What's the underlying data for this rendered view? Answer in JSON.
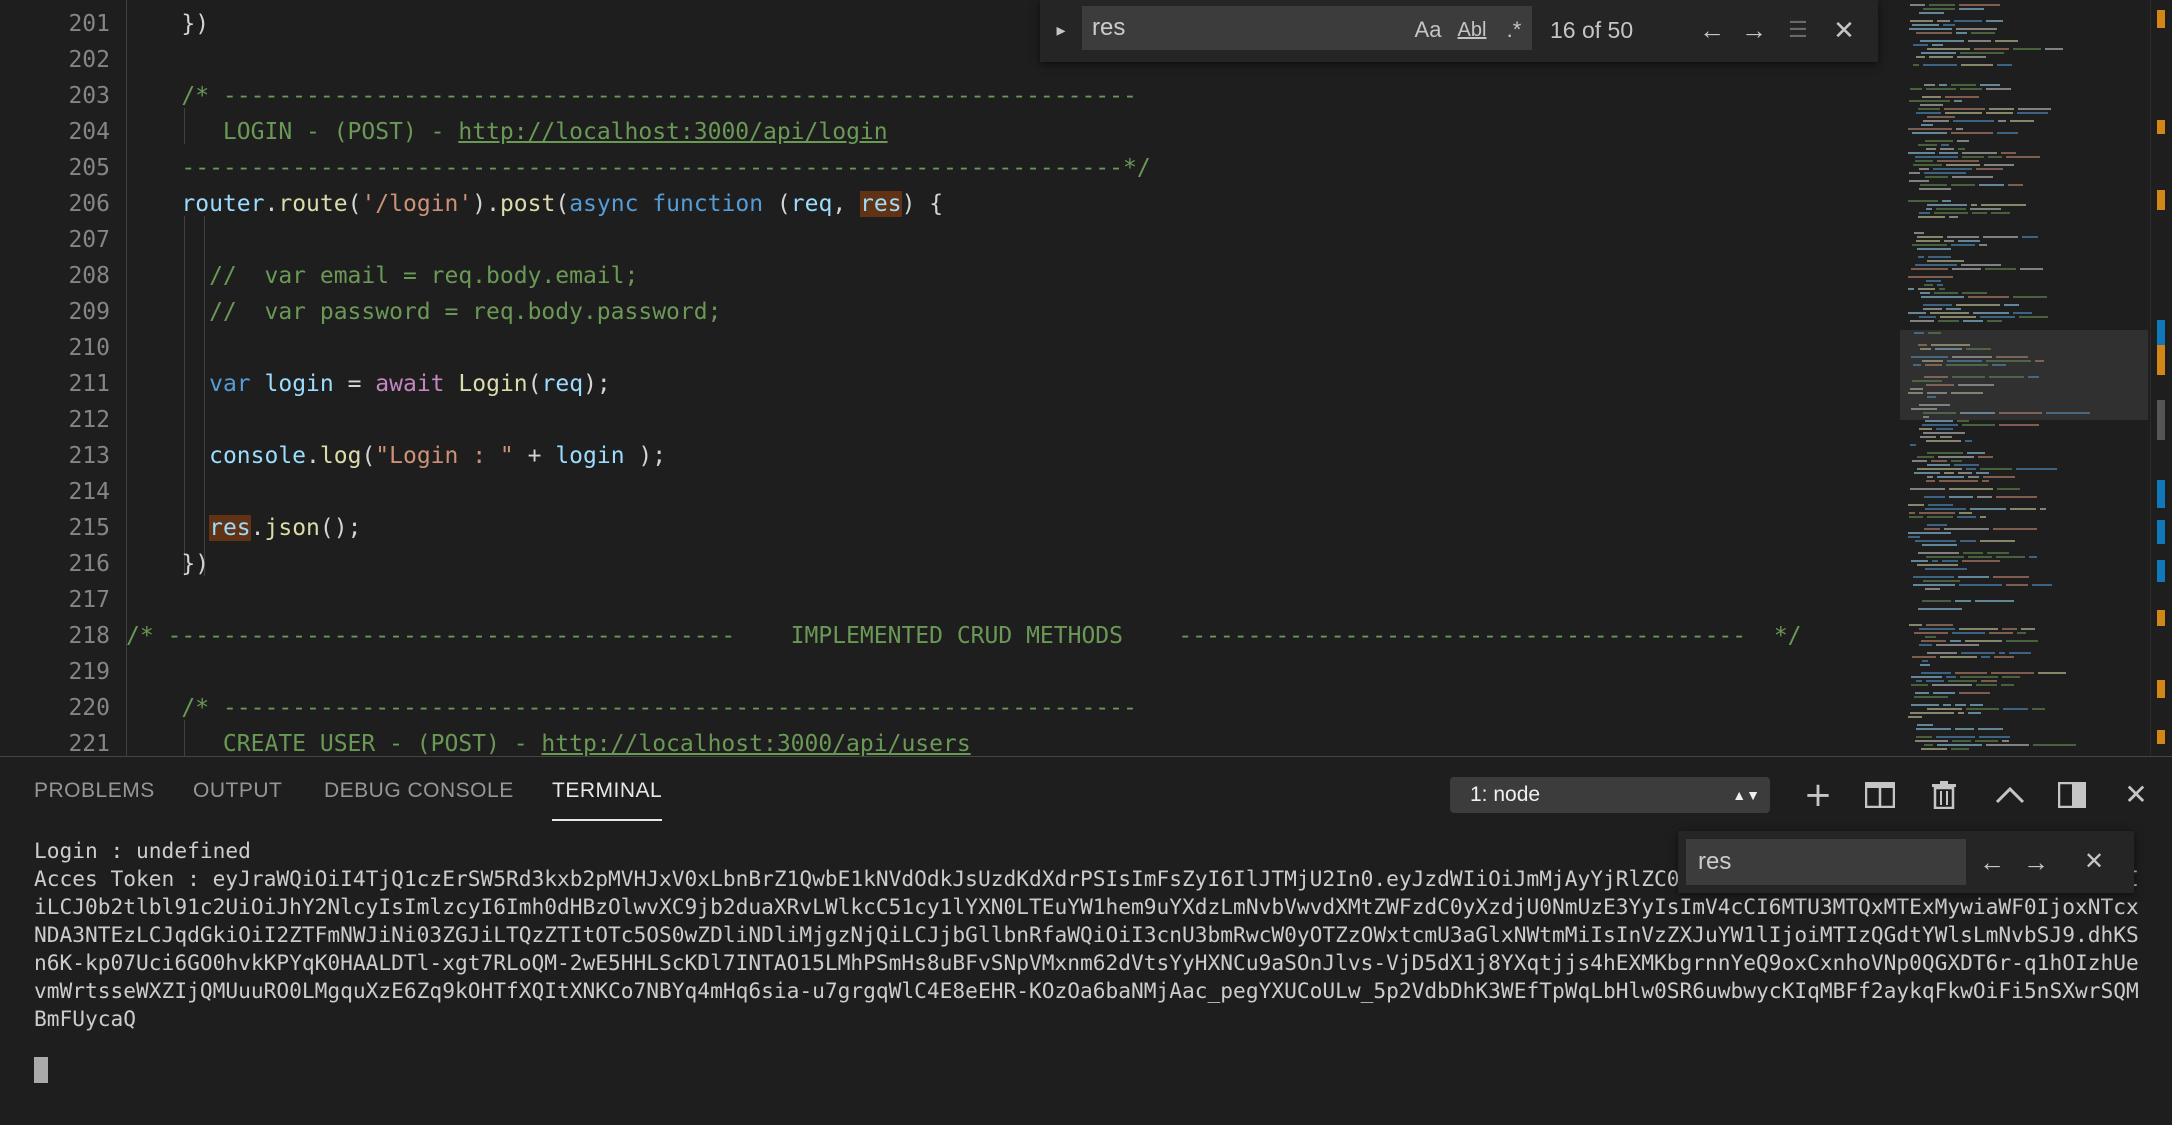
{
  "editor": {
    "line_numbers": [
      "201",
      "202",
      "203",
      "204",
      "205",
      "206",
      "207",
      "208",
      "209",
      "210",
      "211",
      "212",
      "213",
      "214",
      "215",
      "216",
      "217",
      "218",
      "219",
      "220",
      "221"
    ]
  },
  "find": {
    "query": "res",
    "match_case_label": "Aa",
    "whole_word_label": "Abl",
    "regex_label": ".*",
    "result": "16 of 50"
  },
  "panel": {
    "tabs": [
      "PROBLEMS",
      "OUTPUT",
      "DEBUG CONSOLE",
      "TERMINAL"
    ],
    "active_tab": "TERMINAL",
    "terminal_select": "1: node"
  },
  "terminal_find": {
    "query": "res"
  },
  "terminal": {
    "lines": [
      "Login : undefined",
      "Acces Token : eyJraWQiOiI4TjQ1czErSW5Rd3kxb2pMVHJxV0xLbnBrZ1QwbE1kNVdOdkJsUzdKdXdrPSIsImFsZyI6IlJTMjU2In0.eyJzdWIiOiJmMjAyYjRlZC0yYjY1LTQxOTgtOWFiZi0wNmI4OTk3ZWJkNmIiLCJ0b2tlbl91c2UiOiJhY2NlcyIsImlzcyI6Imh0dHBzOlwvXC9jb2duaXRvLWlkcC51cy1lYXN0LTEuYW1hem9uYXdzLmNvbVwvdXMtZWFzdC0yXzdjU0NmUzE3YyIsImV4cCI6MTU3MTQxMTExMywiaWF0IjoxNTcxNDA3NTEzLCJqdGkiOiI2ZTFmNWJiNi03ZGJiLTQzZTItOTc5OS0wZDliNDliMjgzNjQiLCJjbGllbnRfaWQiOiI3cnU3bmRwcW0yOTZzOWxtcmU3aGlxNWtmMiIsInVzZXJuYW1lIjoiMTIzQGdtYWlsLmNvbSJ9.dhKSn6K-kp07Uci6GO0hvkKPYqK0HAALDTl-xgt7RLoQM-2wE5HHLScKDl7INTAO15LMhPSmHs8uBFvSNpVMxnm62dVtsYyHXNCu9aSOnJlvs-VjD5dX1j8YXqtjjs4hEXMKbgrnnYeQ9oxCxnhoVNp0QGXDT6r-q1hOIzhUevmWrtsseWXZIjQMUuuRO0LMgquXzE6Zq9kOHTfXQItXNKCo7NBYq4mHq6sia-u7grgqWlC4E8eEHR-KOzOa6baNMjAac_pegYXUCoULw_5p2VdbDhK3WEfTpWqLbHlw0SR6uwbwycKIqMBFf2aykqFkwOiFi5nSXwrSQMBmFUycaQ"
    ]
  },
  "colors": {
    "keyword": "#569cd6",
    "control": "#c586c0",
    "string": "#ce9178",
    "comment": "#6a9955",
    "function": "#dcdcaa",
    "variable": "#9cdcfe",
    "find_highlight": "#613214"
  },
  "icons": [
    "chevron-right-icon",
    "arrow-up-icon",
    "arrow-down-icon",
    "select-in-selection-icon",
    "close-icon",
    "plus-icon",
    "split-icon",
    "trash-icon",
    "chevron-up-icon",
    "maximize-panel-icon"
  ]
}
